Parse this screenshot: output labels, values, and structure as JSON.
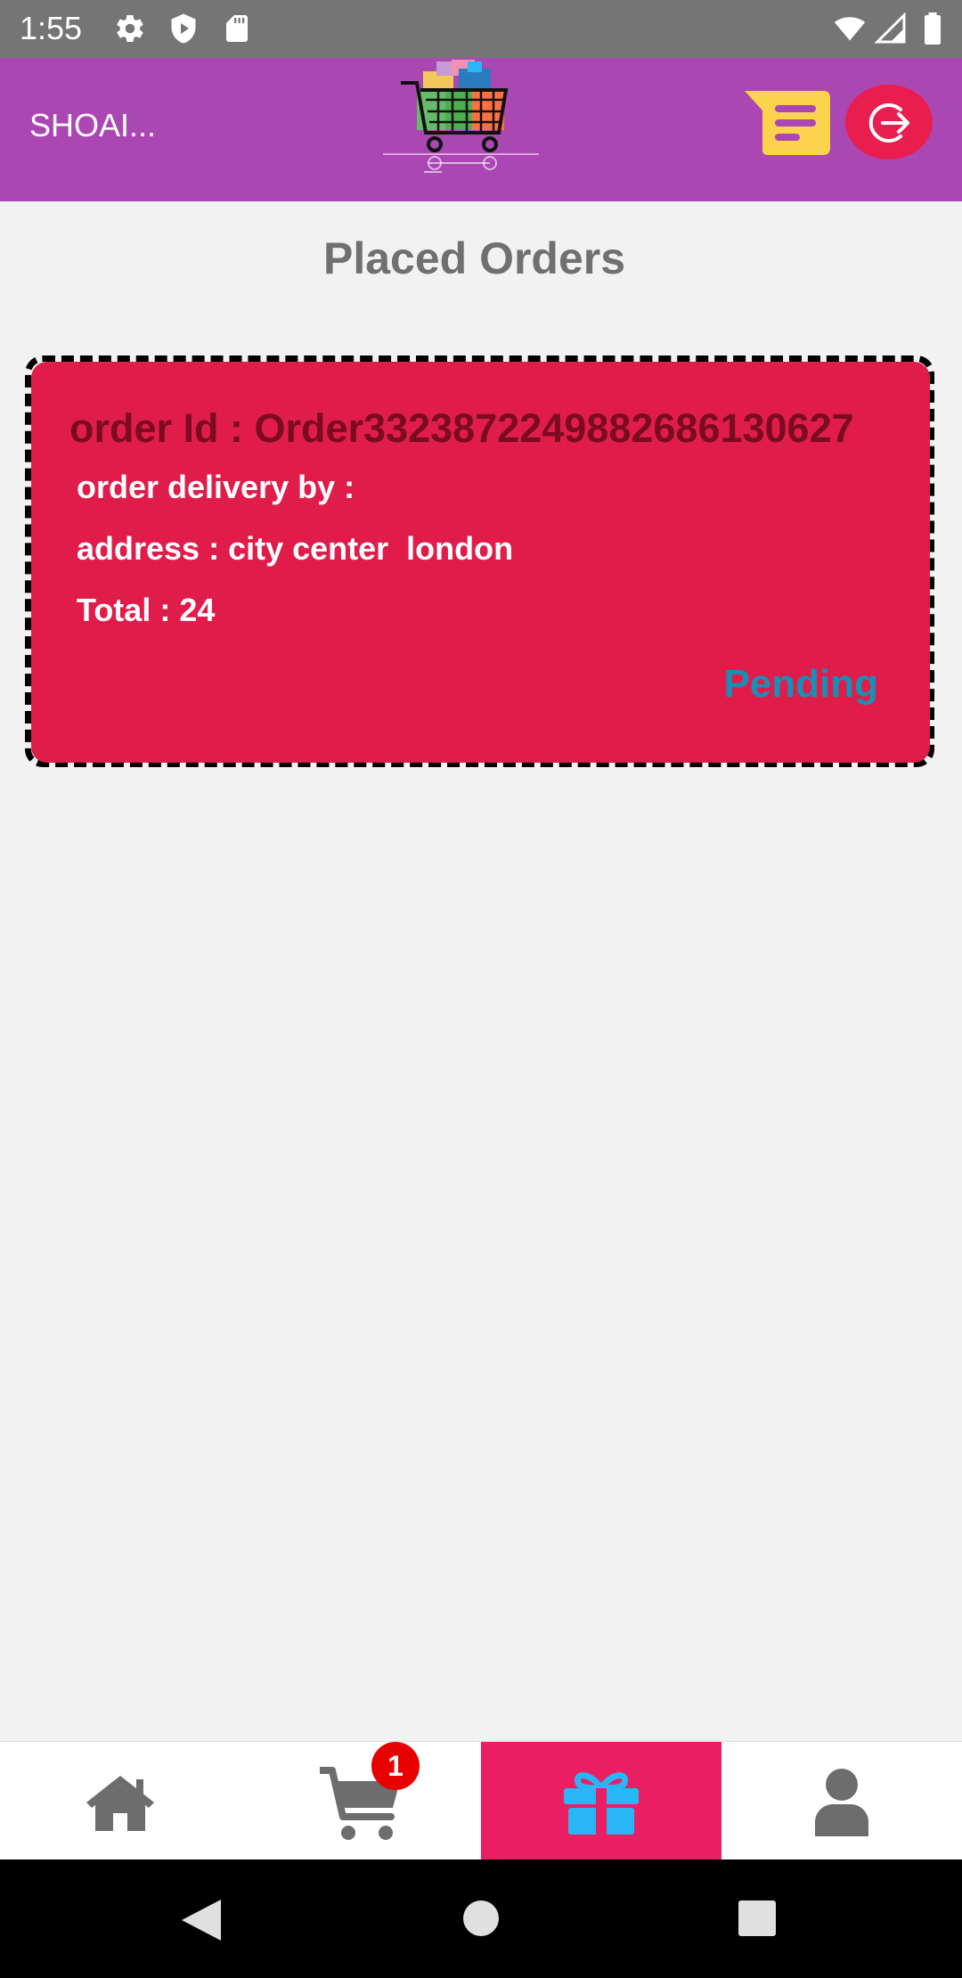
{
  "status_bar": {
    "time": "1:55",
    "icons": [
      "settings-gear-icon",
      "shield-play-icon",
      "sd-card-icon",
      "wifi-icon",
      "signal-icon",
      "battery-icon"
    ]
  },
  "app_bar": {
    "user_name": "SHOAI...",
    "logo": "shopping-cart-logo",
    "actions": [
      "messages-icon",
      "logout-icon"
    ],
    "colors": {
      "background": "#ab47b2",
      "logout": "#e91e4e",
      "messages": "#fcd34d"
    }
  },
  "page": {
    "title": "Placed Orders"
  },
  "orders": [
    {
      "order_id": "order Id : Order33238722498826861306​27",
      "delivery_by": "order delivery by :",
      "address": "address : city center  london",
      "total": "Total : 24",
      "status": "Pending"
    }
  ],
  "bottom_nav": {
    "items": [
      "home-icon",
      "cart-icon",
      "gift-icon",
      "user-icon"
    ],
    "active": "gift-icon",
    "cart_badge": "1",
    "colors": {
      "active_bg": "#e91e63",
      "active_icon": "#29b6f6",
      "icon": "#6d6d6d"
    }
  },
  "system_nav": {
    "buttons": [
      "back-icon",
      "home-circle-icon",
      "recents-square-icon"
    ]
  }
}
